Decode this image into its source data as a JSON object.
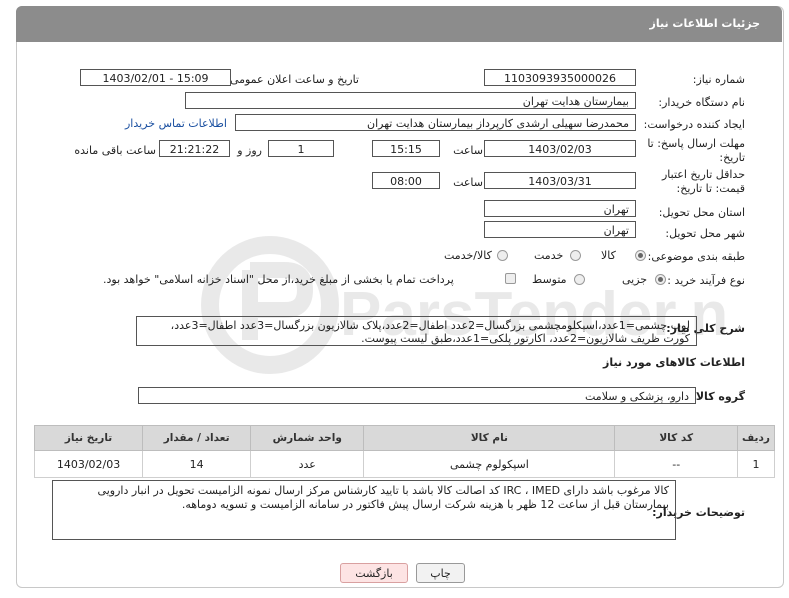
{
  "header": {
    "title": "جزئیات اطلاعات نیاز"
  },
  "form": {
    "need_number_label": "شماره نیاز:",
    "need_number": "1103093935000026",
    "announce_label": "تاریخ و ساعت اعلان عمومی:",
    "announce_value": "1403/02/01 - 15:09",
    "buyer_org_label": "نام دستگاه خریدار:",
    "buyer_org": "بیمارستان هدایت تهران",
    "creator_label": "ایجاد کننده درخواست:",
    "creator": "محمدرضا سهیلی ارشدی کارپرداز بیمارستان هدایت تهران",
    "contact_link": "اطلاعات تماس خریدار",
    "reply_deadline_label": "مهلت ارسال پاسخ: تا تاریخ:",
    "reply_date": "1403/02/03",
    "time_label": "ساعت",
    "reply_time": "15:15",
    "days_value": "1",
    "days_label": "روز و",
    "remaining_value": "21:21:22",
    "remaining_label": "ساعت باقی مانده",
    "price_validity_label": "حداقل تاریخ اعتبار قیمت: تا تاریخ:",
    "validity_date": "1403/03/31",
    "validity_time": "08:00",
    "province_label": "استان محل تحویل:",
    "province": "تهران",
    "city_label": "شهر محل تحویل:",
    "city": "تهران",
    "category_label": "طبقه بندی موضوعی:",
    "category_options": [
      "کالا",
      "خدمت",
      "کالا/خدمت"
    ],
    "process_label": "نوع فرآیند خرید :",
    "process_options": [
      "جزیی",
      "متوسط"
    ],
    "payment_note": "پرداخت تمام یا بخشی از مبلغ خرید،از محل \"اسناد خزانه اسلامی\" خواهد بود."
  },
  "description": {
    "label": "شرح کلی نیاز:",
    "text": "لوپ چشمی=1عدد،اسپکلومچشمی بزرگسال=2عدد اطفال=2عدد،پلاک شالازیون بزرگسال=3عدد اطفال=3عدد، کورت ظریف شالازیون=2عدد، اکارتور پلکی=1عدد،طبق لیست پیوست."
  },
  "goods": {
    "section_title": "اطلاعات کالاهای مورد نیاز",
    "group_label": "گروه کالا:",
    "group_value": "دارو، پزشکی و سلامت",
    "columns": [
      "ردیف",
      "کد کالا",
      "نام کالا",
      "واحد شمارش",
      "تعداد / مقدار",
      "تاریخ نیاز"
    ],
    "rows": [
      {
        "row": "1",
        "code": "--",
        "name": "اسپکولوم چشمی",
        "unit": "عدد",
        "qty": "14",
        "date": "1403/02/03"
      }
    ]
  },
  "notes": {
    "label": "توضیحات خریدار:",
    "text": "کالا مرغوب باشد دارای IRC ، IMED کد اصالت کالا باشد با تایید کارشناس مرکز ارسال نمونه الزامیست تحویل در انبار دارویی بیمارستان قبل از ساعت 12 ظهر با هزینه شرکت ارسال پیش فاکتور در سامانه الزامیست و تسویه دوماهه."
  },
  "buttons": {
    "print": "چاپ",
    "back": "بازگشت"
  },
  "watermark": {
    "text": "ParsTender.net"
  }
}
